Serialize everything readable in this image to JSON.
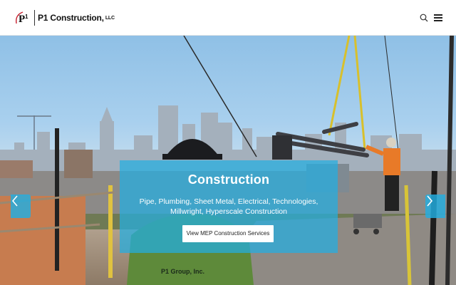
{
  "header": {
    "brand_name": "P1 Construction,",
    "brand_suffix": "LLC",
    "logo_mark": "P1",
    "icons": [
      "search-icon",
      "hamburger-menu-icon"
    ]
  },
  "hero": {
    "title": "Construction",
    "subtitle": "Pipe, Plumbing, Sheet Metal, Electrical, Technologies, Millwright, Hyperscale Construction",
    "button_label": "View MEP Construction Services",
    "shirt_logo_text": "P1 Group, Inc.",
    "prev_icon": "chevron-left-icon",
    "next_icon": "chevron-right-icon"
  },
  "colors": {
    "accent": "#22aee2",
    "header_bg": "#ffffff",
    "logo_red": "#c8202f",
    "text_dark": "#111111"
  }
}
